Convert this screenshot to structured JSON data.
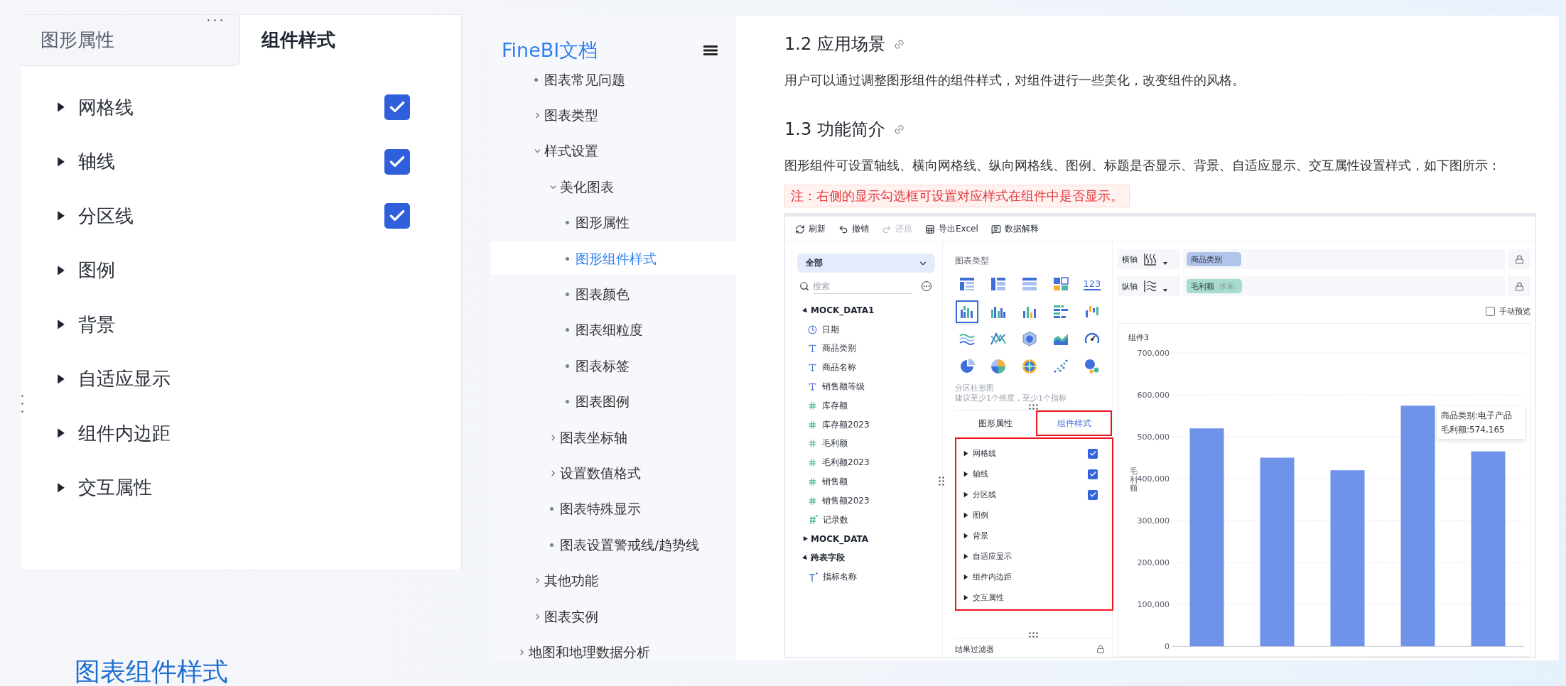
{
  "style_panel": {
    "tabs": [
      {
        "label": "图形属性",
        "selected": false
      },
      {
        "label": "组件样式",
        "selected": true
      }
    ],
    "items": [
      {
        "label": "网格线",
        "kind": "checkbox",
        "checked": true
      },
      {
        "label": "轴线",
        "kind": "checkbox",
        "checked": true
      },
      {
        "label": "分区线",
        "kind": "checkbox",
        "checked": true
      },
      {
        "label": "图例",
        "kind": "section"
      },
      {
        "label": "背景",
        "kind": "section"
      },
      {
        "label": "自适应显示",
        "kind": "section"
      },
      {
        "label": "组件内边距",
        "kind": "section"
      },
      {
        "label": "交互属性",
        "kind": "section"
      }
    ]
  },
  "page_heading": "图表组件样式",
  "nav": {
    "logo": "FineBI文档",
    "items": [
      {
        "children": [
          {
            "label": "图表常见问题",
            "selected": false
          },
          {
            "label": "图表类型",
            "expanded": false,
            "selected": false
          },
          {
            "label": "样式设置",
            "expanded": true,
            "selected": false,
            "children": [
              {
                "label": "美化图表",
                "expanded": true,
                "selected": false,
                "children": [
                  {
                    "label": "图形属性",
                    "selected": false
                  },
                  {
                    "label": "图形组件样式",
                    "selected": true
                  },
                  {
                    "label": "图表颜色",
                    "selected": false
                  },
                  {
                    "label": "图表细粒度",
                    "selected": false
                  },
                  {
                    "label": "图表标签",
                    "selected": false
                  },
                  {
                    "label": "图表图例",
                    "selected": false
                  }
                ]
              },
              {
                "label": "图表坐标轴",
                "expanded": false,
                "selected": false
              },
              {
                "label": "设置数值格式",
                "expanded": false,
                "selected": false
              },
              {
                "label": "图表特殊显示",
                "selected": false
              },
              {
                "label": "图表设置警戒线/趋势线",
                "selected": false
              }
            ]
          },
          {
            "label": "其他功能",
            "expanded": false,
            "selected": false
          },
          {
            "label": "图表实例",
            "expanded": false,
            "selected": false
          }
        ]
      },
      {
        "label": "地图和地理数据分析",
        "expanded": false,
        "selected": false
      }
    ]
  },
  "article": {
    "sections": [
      {
        "heading": "1.2 应用场景",
        "paragraph": "用户可以通过调整图形组件的组件样式，对组件进行一些美化，改变组件的风格。"
      },
      {
        "heading": "1.3 功能简介",
        "paragraph": "图形组件可设置轴线、横向网格线、纵向网格线、图例、标题是否显示、背景、自适应显示、交互属性设置样式，如下图所示：",
        "note": "注：右侧的显示勾选框可设置对应样式在组件中是否显示。"
      }
    ],
    "screenshot": {
      "toolbar": [
        {
          "label": "刷新",
          "disabled": false
        },
        {
          "label": "撤销",
          "disabled": false
        },
        {
          "label": "还原",
          "disabled": true
        },
        {
          "label": "导出Excel",
          "disabled": false
        },
        {
          "label": "数据解释",
          "disabled": false
        }
      ],
      "data_panel": {
        "scope": "全部",
        "search": {
          "placeholder": "搜索"
        },
        "tree": [
          {
            "label": "MOCK_DATA1",
            "expanded": true,
            "children": [
              {
                "label": "日期",
                "kind": "date"
              },
              {
                "label": "商品类别",
                "kind": "text"
              },
              {
                "label": "商品名称",
                "kind": "text"
              },
              {
                "label": "销售额等级",
                "kind": "text"
              },
              {
                "label": "库存额",
                "kind": "number"
              },
              {
                "label": "库存额2023",
                "kind": "number"
              },
              {
                "label": "毛利额",
                "kind": "number"
              },
              {
                "label": "毛利额2023",
                "kind": "number"
              },
              {
                "label": "销售额",
                "kind": "number"
              },
              {
                "label": "销售额2023",
                "kind": "number"
              },
              {
                "label": "记录数",
                "kind": "number_calc"
              }
            ]
          },
          {
            "label": "MOCK_DATA",
            "expanded": false
          },
          {
            "label": "跨表字段",
            "expanded": true,
            "children": [
              {
                "label": "指标名称",
                "kind": "text_calc"
              }
            ]
          }
        ]
      },
      "chart_panel": {
        "title": "图表类型",
        "chart_types": [
          {
            "selected": false
          },
          {
            "selected": false
          },
          {
            "selected": false
          },
          {
            "selected": false
          },
          {
            "selected": false,
            "label": "123"
          },
          {
            "selected": true
          },
          {
            "selected": false
          },
          {
            "selected": false
          },
          {
            "selected": false
          },
          {
            "selected": false
          },
          {
            "selected": false
          },
          {
            "selected": false
          },
          {
            "selected": false
          },
          {
            "selected": false
          },
          {
            "selected": false
          },
          {
            "selected": false
          },
          {
            "selected": false
          },
          {
            "selected": false
          },
          {
            "selected": false
          },
          {
            "selected": false
          }
        ],
        "description": "分区柱形图",
        "hint": "建议至少1个维度，至少1个指标",
        "tabs": [
          {
            "label": "图形属性",
            "selected": false,
            "highlighted": false
          },
          {
            "label": "组件样式",
            "selected": true,
            "highlighted": true
          }
        ],
        "style_list": {
          "highlighted": true,
          "items": [
            {
              "label": "网格线",
              "kind": "checkbox",
              "checked": true
            },
            {
              "label": "轴线",
              "kind": "checkbox",
              "checked": true
            },
            {
              "label": "分区线",
              "kind": "checkbox",
              "checked": true
            },
            {
              "label": "图例",
              "kind": "section"
            },
            {
              "label": "背景",
              "kind": "section"
            },
            {
              "label": "自适应显示",
              "kind": "section"
            },
            {
              "label": "组件内边距",
              "kind": "section"
            },
            {
              "label": "交互属性",
              "kind": "section"
            }
          ]
        },
        "filter_label": "结果过滤器"
      },
      "axes": [
        {
          "label": "横轴",
          "kind": "dimension",
          "field": "商品类别"
        },
        {
          "label": "纵轴",
          "kind": "measure",
          "field": "毛利额",
          "aggregation": "求和"
        }
      ],
      "manual_preview": {
        "label": "手动预览",
        "checked": false
      },
      "widget": {
        "title": "组件3",
        "tooltip": [
          "商品类别:电子产品",
          "毛利额:574,165"
        ],
        "chart_data": {
          "type": "bar",
          "grid": true,
          "ylabel": "毛利额",
          "values": [
            520000,
            450000,
            420000,
            574165,
            465000
          ],
          "ylim": [
            0,
            700000
          ],
          "yticks": [
            {
              "value": 0,
              "label": "0"
            },
            {
              "value": 100000,
              "label": "100,000"
            },
            {
              "value": 200000,
              "label": "200,000"
            },
            {
              "value": 300000,
              "label": "300,000"
            },
            {
              "value": 400000,
              "label": "400,000"
            },
            {
              "value": 500000,
              "label": "500,000"
            },
            {
              "value": 600000,
              "label": "600,000"
            },
            {
              "value": 700000,
              "label": "700,000"
            }
          ]
        }
      }
    }
  }
}
